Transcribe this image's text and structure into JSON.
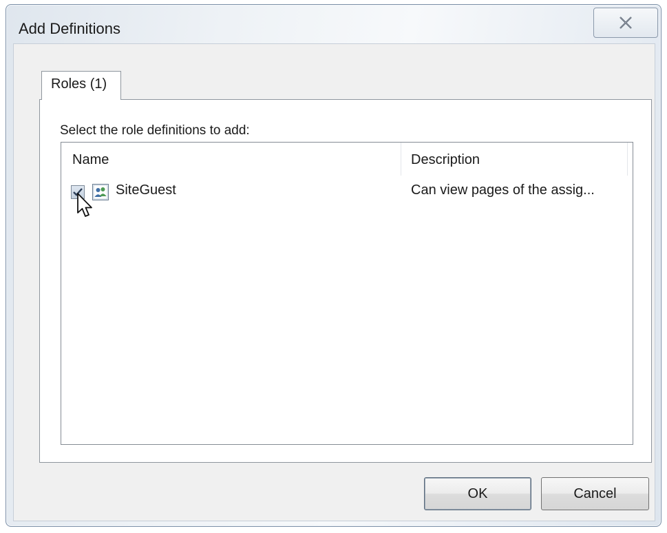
{
  "window": {
    "title": "Add Definitions",
    "close_icon": "close-x-icon"
  },
  "tabs": [
    {
      "label": "Roles (1)",
      "selected": true
    }
  ],
  "panel": {
    "instruction": "Select the role definitions to add:",
    "columns": [
      {
        "label": "Name"
      },
      {
        "label": "Description"
      }
    ],
    "rows": [
      {
        "checked": true,
        "icon": "role-users-icon",
        "name": "SiteGuest",
        "description": "Can view pages of the assig..."
      }
    ]
  },
  "buttons": {
    "ok": "OK",
    "cancel": "Cancel"
  },
  "colors": {
    "window_border": "#7a8ea6",
    "client_background": "#f0f0f0"
  }
}
